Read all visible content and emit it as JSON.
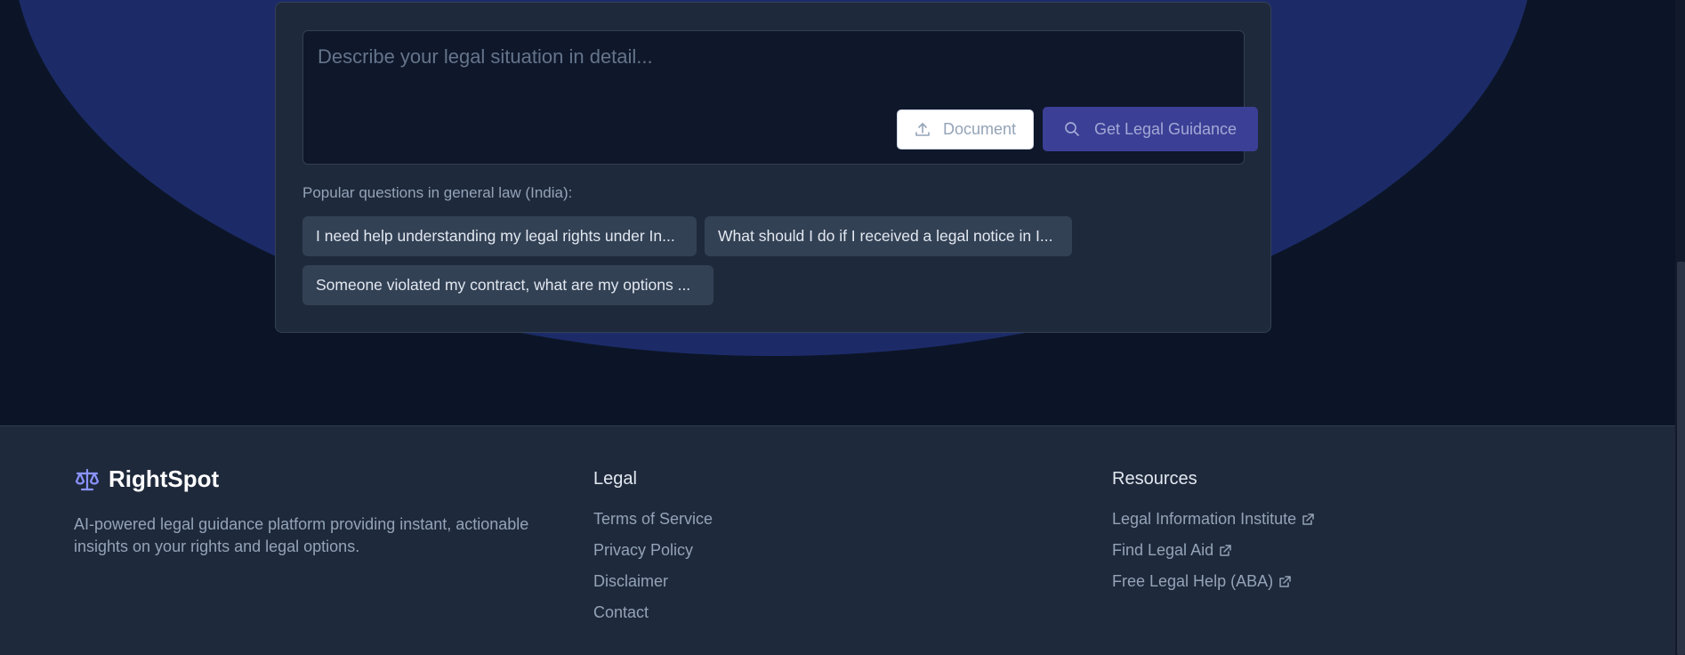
{
  "search": {
    "placeholder": "Describe your legal situation in detail...",
    "document_button": "Document",
    "guidance_button": "Get Legal Guidance"
  },
  "popular": {
    "label": "Popular questions in general law (India):",
    "chips": [
      "I need help understanding my legal rights under In...",
      "What should I do if I received a legal notice in I...",
      "Someone violated my contract, what are my options ..."
    ]
  },
  "footer": {
    "brand": "RightSpot",
    "description": "AI-powered legal guidance platform providing instant, actionable insights on your rights and legal options.",
    "legal": {
      "title": "Legal",
      "links": [
        "Terms of Service",
        "Privacy Policy",
        "Disclaimer",
        "Contact"
      ]
    },
    "resources": {
      "title": "Resources",
      "links": [
        "Legal Information Institute",
        "Find Legal Aid",
        "Free Legal Help (ABA)"
      ]
    }
  },
  "colors": {
    "background": "#0f172a",
    "hero_blob": "#1c2b68",
    "card": "#1e293b",
    "accent_button": "#3b3f95",
    "brand_icon": "#8b93ff"
  },
  "icons": {
    "upload": "upload-icon",
    "search": "search-icon",
    "brand": "scale-icon",
    "external": "external-link-icon"
  }
}
